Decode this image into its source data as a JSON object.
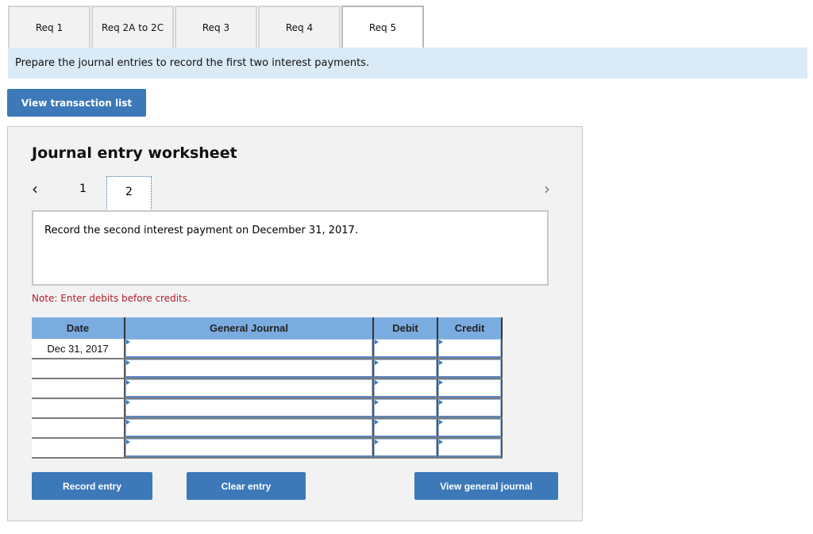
{
  "tabs": [
    {
      "label": "Req 1",
      "active": false
    },
    {
      "label": "Req 2A to 2C",
      "active": false
    },
    {
      "label": "Req 3",
      "active": false
    },
    {
      "label": "Req 4",
      "active": false
    },
    {
      "label": "Req 5",
      "active": true
    }
  ],
  "instruction": "Prepare the journal entries to record the first two interest payments.",
  "view_transaction_list_label": "View transaction list",
  "worksheet": {
    "title": "Journal entry worksheet",
    "nav": {
      "prev_icon": "‹",
      "next_icon": "›",
      "pages": [
        "1",
        "2"
      ],
      "current_page": "2"
    },
    "prompt": "Record the second interest payment on December 31, 2017.",
    "note": "Note: Enter debits before credits.",
    "table": {
      "headers": [
        "Date",
        "General Journal",
        "Debit",
        "Credit"
      ],
      "rows": [
        {
          "date": "Dec 31, 2017",
          "account": "",
          "debit": "",
          "credit": ""
        },
        {
          "date": "",
          "account": "",
          "debit": "",
          "credit": ""
        },
        {
          "date": "",
          "account": "",
          "debit": "",
          "credit": ""
        },
        {
          "date": "",
          "account": "",
          "debit": "",
          "credit": ""
        },
        {
          "date": "",
          "account": "",
          "debit": "",
          "credit": ""
        },
        {
          "date": "",
          "account": "",
          "debit": "",
          "credit": ""
        }
      ]
    },
    "buttons": {
      "record_entry": "Record entry",
      "clear_entry": "Clear entry",
      "view_general_journal": "View general journal"
    }
  },
  "colors": {
    "accent": "#3d79b9",
    "header_blue": "#7bace0",
    "instruction_bg": "#dbeaf7",
    "note_red": "#b0202a"
  }
}
